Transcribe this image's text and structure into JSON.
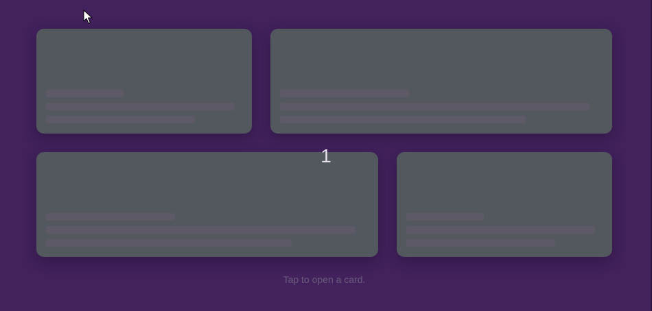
{
  "counter": {
    "value": "1"
  },
  "footer": {
    "hint": "Tap to open a card."
  },
  "cards": [
    {
      "id": "card-1",
      "state": "skeleton"
    },
    {
      "id": "card-2",
      "state": "skeleton"
    },
    {
      "id": "card-3",
      "state": "skeleton"
    },
    {
      "id": "card-4",
      "state": "skeleton"
    }
  ],
  "icons": {
    "cursor": "mouse-pointer-icon"
  },
  "colors": {
    "background": "#42215c",
    "card": "#53575e",
    "skeleton_bar": "#5e5966",
    "hint_text": "#6b5c7c",
    "counter_text": "#e6e1ec"
  }
}
